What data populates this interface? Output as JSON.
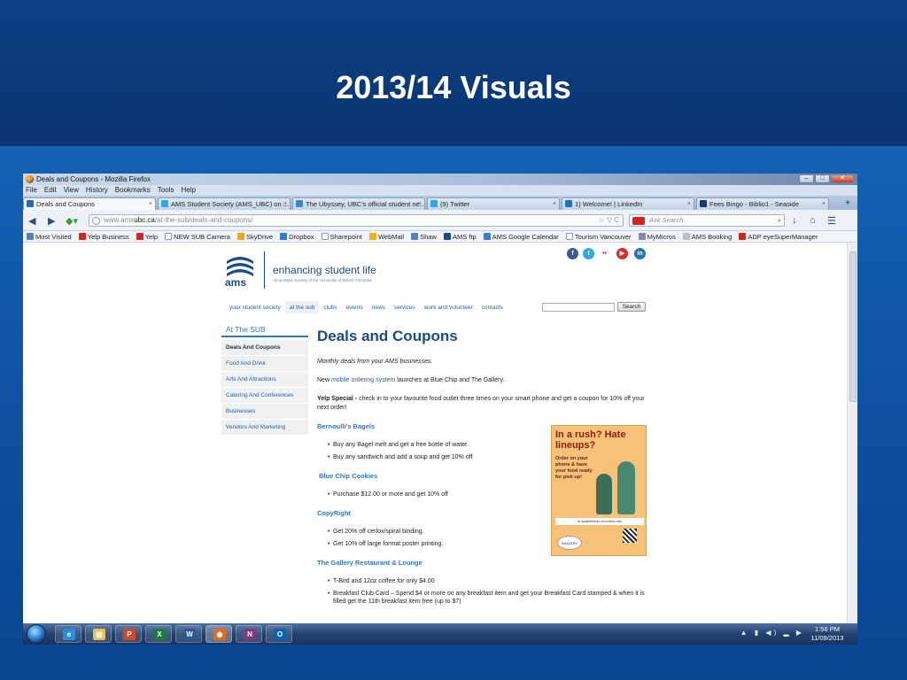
{
  "slide": {
    "title": "2013/14 Visuals"
  },
  "browser": {
    "window_title": "Deals and Coupons - Mozilla Firefox",
    "window_buttons": [
      "–",
      "□",
      "✕"
    ],
    "menu": [
      "File",
      "Edit",
      "View",
      "History",
      "Bookmarks",
      "Tools",
      "Help"
    ],
    "tabs": [
      {
        "label": "Deals and Coupons",
        "active": true
      },
      {
        "label": "AMS Student Society (AMS_UBC) on ...",
        "active": false
      },
      {
        "label": "The Ubyssey, UBC's official student ne...",
        "active": false
      },
      {
        "label": "(9) Twitter",
        "active": false
      },
      {
        "label": "1) Welcome! | LinkedIn",
        "active": false
      },
      {
        "label": "Fees Bingo - Biblio1 - Seaside",
        "active": false
      }
    ],
    "url_prefix": "www.ams",
    "url_domain": "ubc.ca",
    "url_path": "/at-the-sub/deals-and-coupons/",
    "search_placeholder": "Ask Search",
    "bookmarks": [
      {
        "label": "Most Visited",
        "color": "#5a7fb5"
      },
      {
        "label": "Yelp Business",
        "color": "#d32323"
      },
      {
        "label": "Yelp",
        "color": "#d32323"
      },
      {
        "label": "NEW SUB Camera",
        "color": "#ffffff"
      },
      {
        "label": "SkyDrive",
        "color": "#f5a623"
      },
      {
        "label": "Dropbox",
        "color": "#2f7fd1"
      },
      {
        "label": "Sharepoint",
        "color": "#ffffff"
      },
      {
        "label": "WebMail",
        "color": "#f0b400"
      },
      {
        "label": "Shaw",
        "color": "#5a7fb5"
      },
      {
        "label": "AMS ftp",
        "color": "#1b4b86"
      },
      {
        "label": "AMS Google Calendar",
        "color": "#3a7bd5"
      },
      {
        "label": "Tourism Vancouver",
        "color": "#ffffff"
      },
      {
        "label": "MyMicros",
        "color": "#8888aa"
      },
      {
        "label": "AMS Booking",
        "color": "#c0c0c0"
      },
      {
        "label": "ADP eyeSuperManager",
        "color": "#d32323"
      }
    ]
  },
  "page": {
    "logo_text": "ams",
    "tagline": "enhancing student life",
    "tagline_sub": "Alma Mater Society of the University of British Columbia",
    "social": [
      {
        "name": "facebook",
        "glyph": "f",
        "color": "#3b5998"
      },
      {
        "name": "twitter",
        "glyph": "t",
        "color": "#2fa8e0"
      },
      {
        "name": "flickr",
        "glyph": "••",
        "color": "#ff0084"
      },
      {
        "name": "youtube",
        "glyph": "▶",
        "color": "#d62d2d"
      },
      {
        "name": "linkedin",
        "glyph": "in",
        "color": "#1f74b5"
      }
    ],
    "nav": [
      "your student society",
      "at the sub",
      "clubs",
      "events",
      "news",
      "services",
      "work and volunteer",
      "contacts"
    ],
    "search_button": "Search",
    "sidebar_title": "At The SUB",
    "sidebar": [
      "Deals And Coupons",
      "Food And Drink",
      "Arts And Attractions",
      "Catering And Conferences",
      "Businesses",
      "Vendors And Marketing"
    ],
    "heading": "Deals and Coupons",
    "intro": "Monthly deals from your AMS businesses.",
    "mobile_pre": "New ",
    "mobile_link": "mobile ordering system",
    "mobile_post": " launches at Blue Chip and The Gallery.",
    "yelp_bold": "Yelp Special -",
    "yelp_text": " check in to your favourite food outlet three times on your smart phone and get a coupon for 10% off your next order!",
    "sections": [
      {
        "title": "Bernoulli's Bagels",
        "items": [
          "Buy any Bagel melt and get a free bottle of water.",
          "Buy any sandwich and add a soup and get 10% off"
        ]
      },
      {
        "title": "Blue Chip Cookies",
        "items": [
          "Purchase $12.00 or more and get 10% off"
        ]
      },
      {
        "title": "CopyRight",
        "items": [
          "Get 20% off  cerlox/spiral binding.",
          "Get 10% off large format poster  printing."
        ]
      },
      {
        "title": "The Gallery Restaurant & Lounge",
        "items": [
          "T-Bird and 12oz coffee for only $4.00",
          "Breakfast Club Card – Spend $4 or more on any breakfast item and get your Breakfast Card stamped & when it is filled get the 11th breakfast item free (up to $7)"
        ]
      }
    ],
    "poster": {
      "headline": "In a rush? Hate lineups?",
      "sub": "Order on your phone & have your food ready for pick up!",
      "url": "m.tastefulstart.com/ams-ubc",
      "venue": "GALLERY"
    }
  },
  "taskbar": {
    "apps": [
      {
        "name": "ie",
        "glyph": "e",
        "color": "#2d8be0"
      },
      {
        "name": "explorer",
        "glyph": "▤",
        "color": "#e7c05a"
      },
      {
        "name": "powerpoint",
        "glyph": "P",
        "color": "#d24726"
      },
      {
        "name": "excel",
        "glyph": "X",
        "color": "#1f7a3f"
      },
      {
        "name": "word",
        "glyph": "W",
        "color": "#2b5797"
      },
      {
        "name": "firefox",
        "glyph": "◉",
        "color": "#e66a12"
      },
      {
        "name": "onenote",
        "glyph": "N",
        "color": "#80397b"
      },
      {
        "name": "outlook",
        "glyph": "O",
        "color": "#0a64ad"
      }
    ],
    "tray": "▲ ▮ ◀) ▂ ▶",
    "time": "1:56 PM",
    "date": "11/09/2013"
  }
}
